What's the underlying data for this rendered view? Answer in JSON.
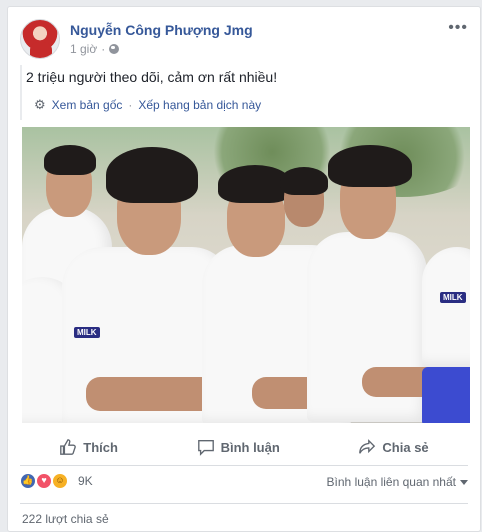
{
  "post": {
    "author": "Nguyễn Công Phượng Jmg",
    "time": "1 giờ",
    "privacy_icon": "globe-icon",
    "more_icon": "ellipsis-icon",
    "text": "2 triệu người theo dõi, cảm ơn rất nhiều!",
    "translation": {
      "see_original": "Xem bản gốc",
      "separator": "·",
      "rate_translation": "Xếp hạng bản dịch này"
    },
    "photo": {
      "description_icon": "photo-players",
      "shirt_brand": "MILK"
    }
  },
  "actions": {
    "like": "Thích",
    "comment": "Bình luận",
    "share": "Chia sẻ"
  },
  "footer": {
    "reactions": [
      "like",
      "love",
      "haha"
    ],
    "reaction_count": "9K",
    "sort_label": "Bình luận liên quan nhất",
    "share_count": "222 lượt chia sẻ"
  },
  "colors": {
    "link": "#365899",
    "muted": "#606770",
    "chair": "#3c4bd0"
  }
}
